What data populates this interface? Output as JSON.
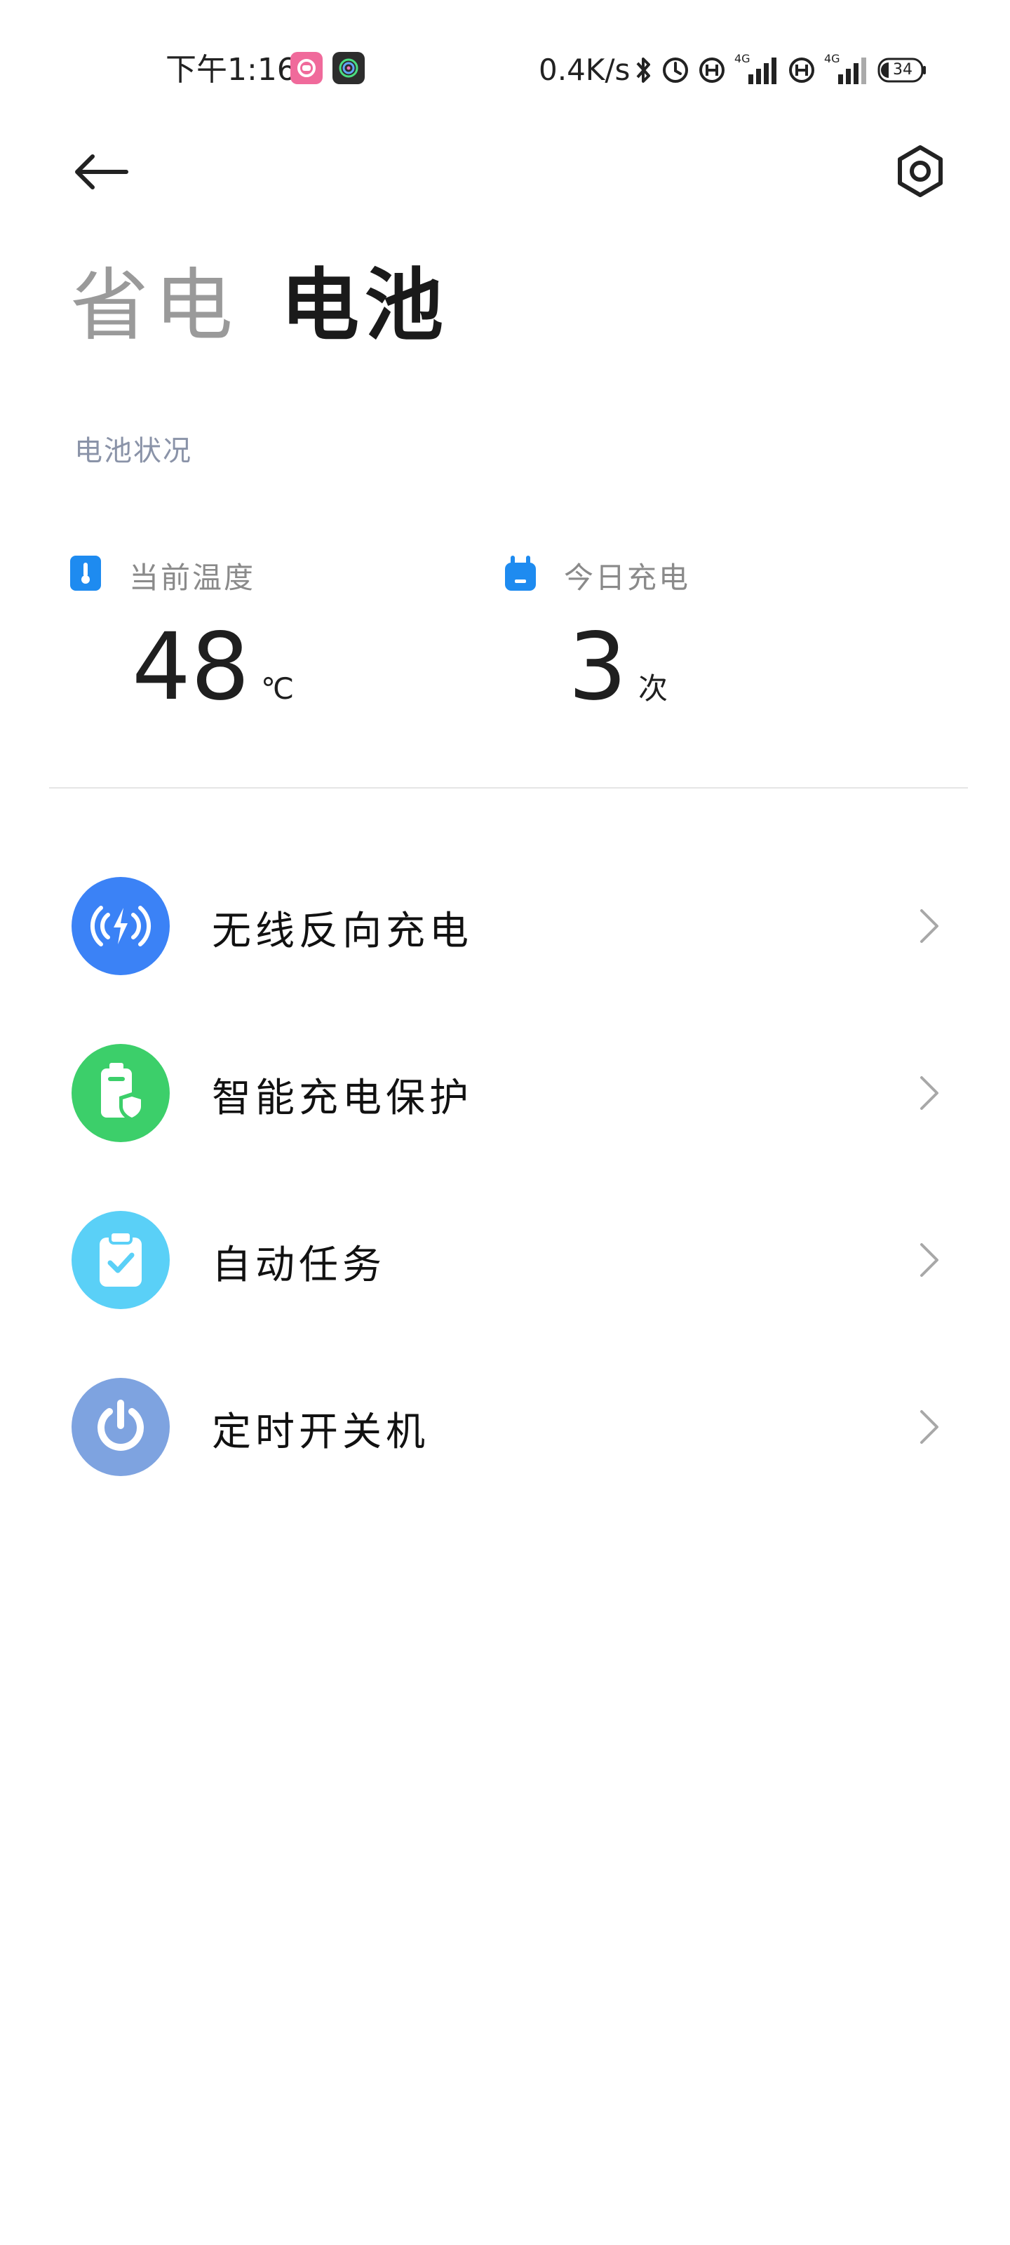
{
  "status_bar": {
    "time": "下午1:16",
    "network_speed": "0.4K/s",
    "battery_level": "34",
    "network_type_1": "4G",
    "network_type_2": "4G"
  },
  "tabs": [
    {
      "label": "省电",
      "active": false
    },
    {
      "label": "电池",
      "active": true
    }
  ],
  "battery_status": {
    "section_label": "电池状况",
    "temperature": {
      "label": "当前温度",
      "value": "48",
      "unit": "℃"
    },
    "charge_today": {
      "label": "今日充电",
      "value": "3",
      "unit": "次"
    }
  },
  "menu": {
    "items": [
      {
        "label": "无线反向充电",
        "icon": "wireless-reverse-charge-icon",
        "color": "#3b82f6"
      },
      {
        "label": "智能充电保护",
        "icon": "smart-charge-protect-icon",
        "color": "#3ccf6a"
      },
      {
        "label": "自动任务",
        "icon": "auto-task-icon",
        "color": "#5ad0f7"
      },
      {
        "label": "定时开关机",
        "icon": "scheduled-power-icon",
        "color": "#7ea3e0"
      }
    ]
  },
  "colors": {
    "tab_inactive": "#9a9a9a",
    "tab_active": "#1a1a1a",
    "section_label": "#8a93a8",
    "stat_icon_blue": "#1e8bf0"
  }
}
